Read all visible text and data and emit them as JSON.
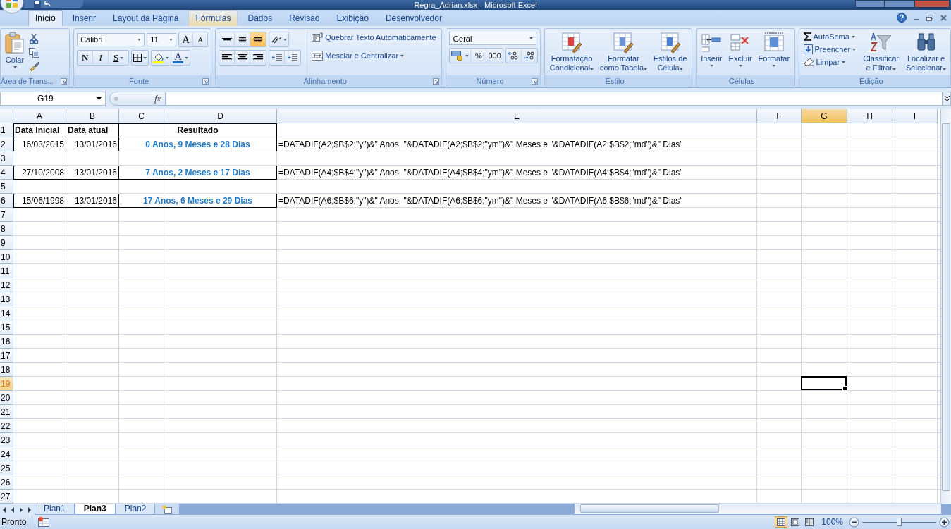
{
  "window": {
    "title": "Regra_Adrian.xlsx - Microsoft Excel"
  },
  "ribbon_tabs": [
    {
      "label": "Início",
      "selected": true,
      "hovered": false
    },
    {
      "label": "Inserir",
      "selected": false,
      "hovered": false
    },
    {
      "label": "Layout da Página",
      "selected": false,
      "hovered": false
    },
    {
      "label": "Fórmulas",
      "selected": false,
      "hovered": true
    },
    {
      "label": "Dados",
      "selected": false,
      "hovered": false
    },
    {
      "label": "Revisão",
      "selected": false,
      "hovered": false
    },
    {
      "label": "Exibição",
      "selected": false,
      "hovered": false
    },
    {
      "label": "Desenvolvedor",
      "selected": false,
      "hovered": false
    }
  ],
  "clipboard": {
    "paste": "Colar",
    "group": "Área de Trans..."
  },
  "font": {
    "name": "Calibri",
    "size": "11",
    "grow": "A",
    "shrink": "A",
    "bold": "N",
    "italic": "I",
    "underline": "S",
    "font_color": "A",
    "group": "Fonte"
  },
  "alignment": {
    "vertical_buttons": [
      {
        "selected": false
      },
      {
        "selected": false
      },
      {
        "selected": true
      }
    ],
    "wrap": "Quebrar Texto Automaticamente",
    "merge": "Mesclar e Centralizar",
    "group": "Alinhamento"
  },
  "number": {
    "format": "Geral",
    "percent": "%",
    "thousands": "000",
    "group": "Número"
  },
  "styles": {
    "buttons": [
      "Formatação\nCondicional",
      "Formatar\ncomo Tabela",
      "Estilos de\nCélula"
    ],
    "group": "Estilo"
  },
  "cells": {
    "buttons": [
      "Inserir",
      "Excluir",
      "Formatar"
    ],
    "group": "Células"
  },
  "editing": {
    "autosum": "AutoSoma",
    "fill": "Preencher",
    "clear": "Limpar",
    "sort": "Classificar\ne Filtrar",
    "find": "Localizar e\nSelecionar",
    "group": "Edição"
  },
  "formula_bar": {
    "name_box": "G19",
    "fx": "fx"
  },
  "sheet": {
    "columns": [
      {
        "label": "A",
        "selected": false
      },
      {
        "label": "B",
        "selected": false
      },
      {
        "label": "C",
        "selected": false
      },
      {
        "label": "D",
        "selected": false
      },
      {
        "label": "E",
        "selected": false
      },
      {
        "label": "F",
        "selected": false
      },
      {
        "label": "G",
        "selected": true
      },
      {
        "label": "H",
        "selected": false
      },
      {
        "label": "I",
        "selected": false
      }
    ],
    "rows": [
      {
        "header": "1",
        "selected": false,
        "kind": "heading",
        "start_date": "Data Inicial",
        "current_date": "Data atual",
        "result": "Resultado"
      },
      {
        "header": "2",
        "selected": false,
        "kind": "data",
        "start_date": "16/03/2015",
        "current_date": "13/01/2016",
        "result": "0 Anos, 9 Meses e 28 Dias",
        "formula": "=DATADIF(A2;$B$2;\"y\")&\" Anos, \"&DATADIF(A2;$B$2;\"ym\")&\" Meses e \"&DATADIF(A2;$B$2;\"md\")&\" Dias\""
      },
      {
        "header": "3",
        "selected": false
      },
      {
        "header": "4",
        "selected": false,
        "kind": "data",
        "start_date": "27/10/2008",
        "current_date": "13/01/2016",
        "result": "7 Anos, 2 Meses e 17 Dias",
        "formula": "=DATADIF(A4;$B$4;\"y\")&\" Anos, \"&DATADIF(A4;$B$4;\"ym\")&\" Meses e \"&DATADIF(A4;$B$4;\"md\")&\" Dias\""
      },
      {
        "header": "5",
        "selected": false
      },
      {
        "header": "6",
        "selected": false,
        "kind": "data",
        "start_date": "15/06/1998",
        "current_date": "13/01/2016",
        "result": "17 Anos, 6 Meses e 29 Dias",
        "formula": "=DATADIF(A6;$B$6;\"y\")&\" Anos, \"&DATADIF(A6;$B$6;\"ym\")&\" Meses e \"&DATADIF(A6;$B$6;\"md\")&\" Dias\""
      },
      {
        "header": "7",
        "selected": false
      },
      {
        "header": "8",
        "selected": false
      },
      {
        "header": "9",
        "selected": false
      },
      {
        "header": "10",
        "selected": false
      },
      {
        "header": "11",
        "selected": false
      },
      {
        "header": "12",
        "selected": false
      },
      {
        "header": "13",
        "selected": false
      },
      {
        "header": "14",
        "selected": false
      },
      {
        "header": "15",
        "selected": false
      },
      {
        "header": "16",
        "selected": false
      },
      {
        "header": "17",
        "selected": false
      },
      {
        "header": "18",
        "selected": false
      },
      {
        "header": "19",
        "selected": true
      },
      {
        "header": "20",
        "selected": false
      },
      {
        "header": "21",
        "selected": false
      },
      {
        "header": "22",
        "selected": false
      },
      {
        "header": "23",
        "selected": false
      },
      {
        "header": "24",
        "selected": false
      },
      {
        "header": "25",
        "selected": false
      },
      {
        "header": "26",
        "selected": false
      },
      {
        "header": "27",
        "selected": false
      }
    ]
  },
  "sheet_tabs": [
    {
      "label": "Plan1",
      "selected": false
    },
    {
      "label": "Plan3",
      "selected": true
    },
    {
      "label": "Plan2",
      "selected": false
    }
  ],
  "status_bar": {
    "text": "Pronto",
    "views": [
      {
        "selected": true
      },
      {
        "selected": false
      },
      {
        "selected": false
      }
    ],
    "zoom": "100%",
    "zoom_slider": {
      "level": 0.5
    }
  }
}
